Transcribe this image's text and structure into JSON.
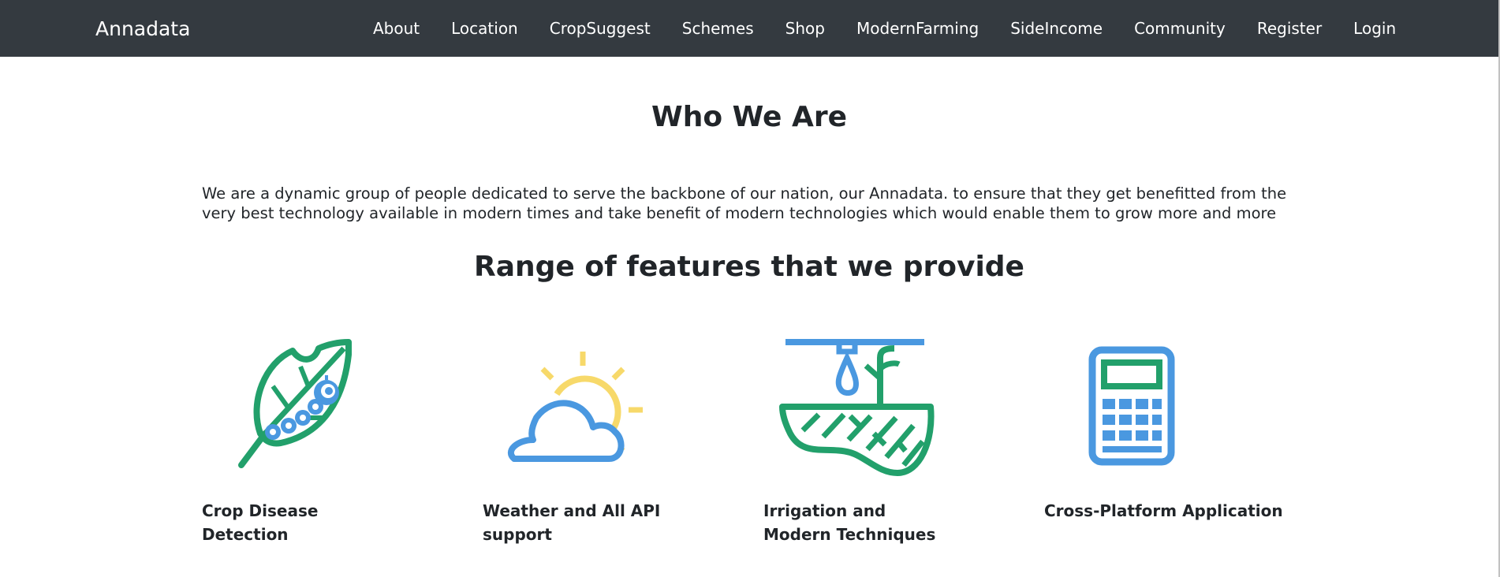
{
  "nav": {
    "brand": "Annadata",
    "links": [
      "About",
      "Location",
      "CropSuggest",
      "Schemes",
      "Shop",
      "ModernFarming",
      "SideIncome",
      "Community",
      "Register",
      "Login"
    ]
  },
  "about": {
    "title": "Who We Are",
    "text": "We are a dynamic group of people dedicated to serve the backbone of our nation, our Annadata. to ensure that they get benefitted from the very best technology available in modern times and take benefit of modern technologies which would enable them to grow more and more"
  },
  "features": {
    "title": "Range of features that we provide",
    "items": [
      {
        "label": "Crop Disease Detection",
        "icon": "leaf-caterpillar-icon"
      },
      {
        "label": "Weather and All API support",
        "icon": "sun-cloud-icon"
      },
      {
        "label": "Irrigation and Modern Techniques",
        "icon": "irrigation-icon"
      },
      {
        "label": "Cross-Platform Application",
        "icon": "calculator-icon"
      }
    ]
  },
  "colors": {
    "navbar": "#343a40",
    "green": "#22a06b",
    "blue": "#4a98e0",
    "yellow": "#f7d96a"
  }
}
